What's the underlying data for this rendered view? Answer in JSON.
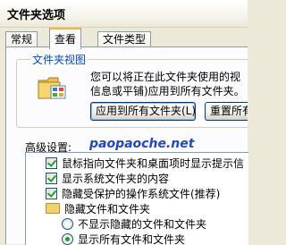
{
  "window": {
    "title": "文件夹选项"
  },
  "tabs": [
    {
      "label": "常规",
      "active": false
    },
    {
      "label": "查看",
      "active": true
    },
    {
      "label": "文件类型",
      "active": false
    }
  ],
  "folder_views": {
    "group_label": "文件夹视图",
    "description_line1": "您可以将正在此文件夹使用的视",
    "description_line2": "信息或平铺)应用到所有文件夹。",
    "apply_all_button": "应用到所有文件夹(L)",
    "reset_all_button": "重置所有"
  },
  "advanced": {
    "label": "高级设置:",
    "watermark": "paopaoche.net",
    "items": [
      {
        "type": "checkbox",
        "checked": true,
        "label": "鼠标指向文件夹和桌面项时显示提示信"
      },
      {
        "type": "checkbox",
        "checked": true,
        "label": "显示系统文件夹的内容"
      },
      {
        "type": "checkbox",
        "checked": true,
        "label": "隐藏受保护的操作系统文件(推荐)"
      },
      {
        "type": "folder",
        "label": "隐藏文件和文件夹"
      },
      {
        "type": "radio",
        "checked": false,
        "label": "不显示隐藏的文件和文件夹"
      },
      {
        "type": "radio",
        "checked": true,
        "label": "显示所有文件和文件夹"
      }
    ]
  },
  "colors": {
    "accent_tab": "#f8b33c",
    "group_label": "#0046D5",
    "check_mark": "#21a121"
  }
}
